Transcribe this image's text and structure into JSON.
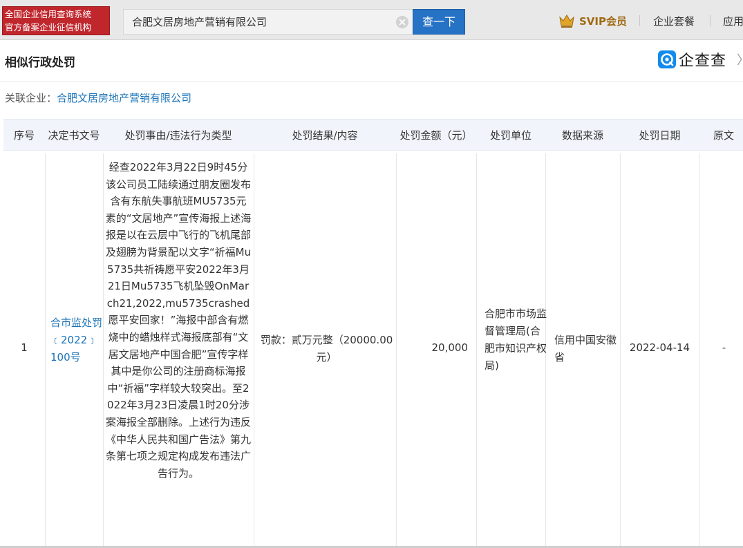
{
  "topbar": {
    "logo_lines": [
      "全国企业信用查询系统",
      "官方备案企业征信机构"
    ],
    "search_value": "合肥文居房地产营销有限公司",
    "search_button": "查一下",
    "svip_label": "SVIP会员",
    "nav": [
      "企业套餐",
      "应用"
    ]
  },
  "header": {
    "title": "相似行政处罚",
    "brand": "企查查"
  },
  "related": {
    "label": "关联企业：",
    "company": "合肥文居房地产营销有限公司"
  },
  "table": {
    "columns": [
      "序号",
      "决定书文号",
      "处罚事由/违法行为类型",
      "处罚结果/内容",
      "处罚金额（元）",
      "处罚单位",
      "数据来源",
      "处罚日期",
      "原文"
    ],
    "rows": [
      {
        "index": "1",
        "doc_no": "合市监处罚﹝2022﹞100号",
        "reason": "经查2022年3月22日9时45分该公司员工陆续通过朋友圈发布含有东航失事航班MU5735元素的“文居地产”宣传海报上述海报是以在云层中飞行的飞机尾部及翅膀为背景配以文字“祈福Mu5735共祈祷愿平安2022年3月21日Mu5735飞机坠毁OnMarch21,2022,mu5735crashed愿平安回家！”海报中部含有燃烧中的蜡烛样式海报底部有“文居文居地产中国合肥”宣传字样其中是你公司的注册商标海报中“祈福”字样较大较突出。至2022年3月23日凌晨1时20分涉案海报全部删除。上述行为违反《中华人民共和国广告法》第九条第七项之规定构成发布违法广告行为。",
        "result": "罚款：贰万元整（20000.00元）",
        "amount": "20,000",
        "department": "合肥市市场监督管理局(合肥市知识产权局)",
        "source": "信用中国安徽省",
        "date": "2022-04-14",
        "original": "-"
      }
    ]
  },
  "colors": {
    "logo_bg": "#c0272d",
    "search_button_bg": "#2672c5",
    "link": "#1a73b8",
    "header_row_bg": "#f1f5fb",
    "svip_gold": "#a06a12",
    "brand_blue": "#128bed"
  },
  "icons": [
    "crown-icon",
    "clear-icon",
    "qichacha-logo-icon"
  ]
}
